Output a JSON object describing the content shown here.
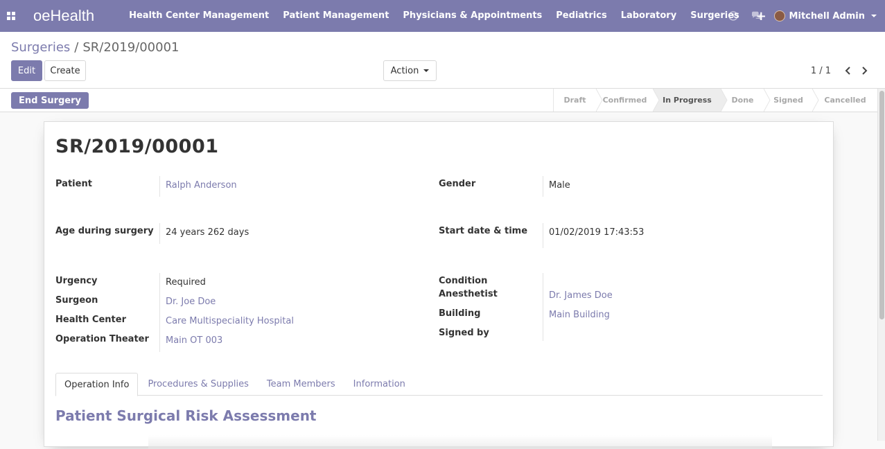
{
  "navbar": {
    "brand": "oeHealth",
    "menu": [
      "Health Center Management",
      "Patient Management",
      "Physicians & Appointments",
      "Pediatrics",
      "Laboratory",
      "Surgeries"
    ],
    "plus": "+",
    "user_name": "Mitchell Admin"
  },
  "breadcrumb": {
    "parent": "Surgeries",
    "separator": "/",
    "current": "SR/2019/00001"
  },
  "toolbar": {
    "edit_label": "Edit",
    "create_label": "Create",
    "action_label": "Action"
  },
  "pager": {
    "counter": "1 / 1"
  },
  "statusbar": {
    "end_button": "End Surgery",
    "stages": [
      "Draft",
      "Confirmed",
      "In Progress",
      "Done",
      "Signed",
      "Cancelled"
    ],
    "active_stage": "In Progress"
  },
  "form": {
    "title": "SR/2019/00001",
    "patient_label": "Patient",
    "patient_value": "Ralph Anderson",
    "gender_label": "Gender",
    "gender_value": "Male",
    "age_label": "Age during surgery",
    "age_value": "24 years 262 days",
    "start_label": "Start date & time",
    "start_value": "01/02/2019 17:43:53",
    "urgency_label": "Urgency",
    "urgency_value": "Required",
    "surgeon_label": "Surgeon",
    "surgeon_value": "Dr. Joe Doe",
    "health_center_label": "Health Center",
    "health_center_value": "Care Multispeciality Hospital",
    "operation_theater_label": "Operation Theater",
    "operation_theater_value": "Main OT 003",
    "condition_label": "Condition",
    "anesthetist_label": "Anesthetist",
    "anesthetist_value": "Dr. James Doe",
    "building_label": "Building",
    "building_value": "Main Building",
    "signed_by_label": "Signed by"
  },
  "tabs": [
    "Operation Info",
    "Procedures & Supplies",
    "Team Members",
    "Information"
  ],
  "section_title": "Patient Surgical Risk Assessment",
  "colors": {
    "brand": "#7c7bad",
    "active_stage_bg": "#ededed"
  }
}
